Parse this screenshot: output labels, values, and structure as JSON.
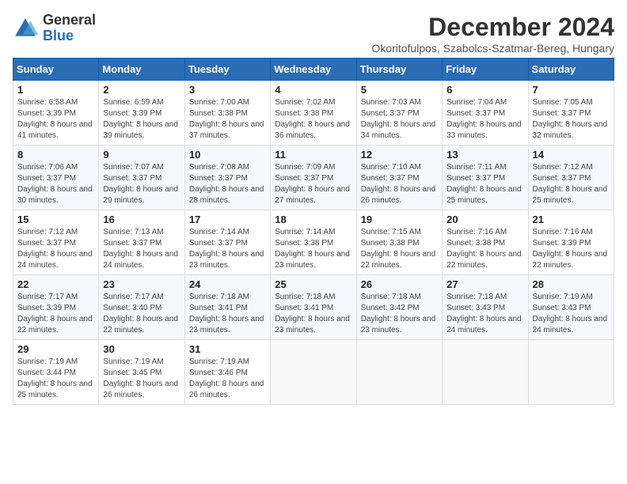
{
  "header": {
    "logo_general": "General",
    "logo_blue": "Blue",
    "title": "December 2024",
    "subtitle": "Okoritofulpos, Szabolcs-Szatmar-Bereg, Hungary"
  },
  "weekdays": [
    "Sunday",
    "Monday",
    "Tuesday",
    "Wednesday",
    "Thursday",
    "Friday",
    "Saturday"
  ],
  "weeks": [
    [
      {
        "day": "1",
        "sunrise": "6:58 AM",
        "sunset": "3:39 PM",
        "daylight": "8 hours and 41 minutes."
      },
      {
        "day": "2",
        "sunrise": "6:59 AM",
        "sunset": "3:39 PM",
        "daylight": "8 hours and 39 minutes."
      },
      {
        "day": "3",
        "sunrise": "7:00 AM",
        "sunset": "3:38 PM",
        "daylight": "8 hours and 37 minutes."
      },
      {
        "day": "4",
        "sunrise": "7:02 AM",
        "sunset": "3:38 PM",
        "daylight": "8 hours and 36 minutes."
      },
      {
        "day": "5",
        "sunrise": "7:03 AM",
        "sunset": "3:37 PM",
        "daylight": "8 hours and 34 minutes."
      },
      {
        "day": "6",
        "sunrise": "7:04 AM",
        "sunset": "3:37 PM",
        "daylight": "8 hours and 33 minutes."
      },
      {
        "day": "7",
        "sunrise": "7:05 AM",
        "sunset": "3:37 PM",
        "daylight": "8 hours and 32 minutes."
      }
    ],
    [
      {
        "day": "8",
        "sunrise": "7:06 AM",
        "sunset": "3:37 PM",
        "daylight": "8 hours and 30 minutes."
      },
      {
        "day": "9",
        "sunrise": "7:07 AM",
        "sunset": "3:37 PM",
        "daylight": "8 hours and 29 minutes."
      },
      {
        "day": "10",
        "sunrise": "7:08 AM",
        "sunset": "3:37 PM",
        "daylight": "8 hours and 28 minutes."
      },
      {
        "day": "11",
        "sunrise": "7:09 AM",
        "sunset": "3:37 PM",
        "daylight": "8 hours and 27 minutes."
      },
      {
        "day": "12",
        "sunrise": "7:10 AM",
        "sunset": "3:37 PM",
        "daylight": "8 hours and 26 minutes."
      },
      {
        "day": "13",
        "sunrise": "7:11 AM",
        "sunset": "3:37 PM",
        "daylight": "8 hours and 25 minutes."
      },
      {
        "day": "14",
        "sunrise": "7:12 AM",
        "sunset": "3:37 PM",
        "daylight": "8 hours and 25 minutes."
      }
    ],
    [
      {
        "day": "15",
        "sunrise": "7:12 AM",
        "sunset": "3:37 PM",
        "daylight": "8 hours and 24 minutes."
      },
      {
        "day": "16",
        "sunrise": "7:13 AM",
        "sunset": "3:37 PM",
        "daylight": "8 hours and 24 minutes."
      },
      {
        "day": "17",
        "sunrise": "7:14 AM",
        "sunset": "3:37 PM",
        "daylight": "8 hours and 23 minutes."
      },
      {
        "day": "18",
        "sunrise": "7:14 AM",
        "sunset": "3:38 PM",
        "daylight": "8 hours and 23 minutes."
      },
      {
        "day": "19",
        "sunrise": "7:15 AM",
        "sunset": "3:38 PM",
        "daylight": "8 hours and 22 minutes."
      },
      {
        "day": "20",
        "sunrise": "7:16 AM",
        "sunset": "3:38 PM",
        "daylight": "8 hours and 22 minutes."
      },
      {
        "day": "21",
        "sunrise": "7:16 AM",
        "sunset": "3:39 PM",
        "daylight": "8 hours and 22 minutes."
      }
    ],
    [
      {
        "day": "22",
        "sunrise": "7:17 AM",
        "sunset": "3:39 PM",
        "daylight": "8 hours and 22 minutes."
      },
      {
        "day": "23",
        "sunrise": "7:17 AM",
        "sunset": "3:40 PM",
        "daylight": "8 hours and 22 minutes."
      },
      {
        "day": "24",
        "sunrise": "7:18 AM",
        "sunset": "3:41 PM",
        "daylight": "8 hours and 23 minutes."
      },
      {
        "day": "25",
        "sunrise": "7:18 AM",
        "sunset": "3:41 PM",
        "daylight": "8 hours and 23 minutes."
      },
      {
        "day": "26",
        "sunrise": "7:18 AM",
        "sunset": "3:42 PM",
        "daylight": "8 hours and 23 minutes."
      },
      {
        "day": "27",
        "sunrise": "7:18 AM",
        "sunset": "3:43 PM",
        "daylight": "8 hours and 24 minutes."
      },
      {
        "day": "28",
        "sunrise": "7:19 AM",
        "sunset": "3:43 PM",
        "daylight": "8 hours and 24 minutes."
      }
    ],
    [
      {
        "day": "29",
        "sunrise": "7:19 AM",
        "sunset": "3:44 PM",
        "daylight": "8 hours and 25 minutes."
      },
      {
        "day": "30",
        "sunrise": "7:19 AM",
        "sunset": "3:45 PM",
        "daylight": "8 hours and 26 minutes."
      },
      {
        "day": "31",
        "sunrise": "7:19 AM",
        "sunset": "3:46 PM",
        "daylight": "8 hours and 26 minutes."
      },
      null,
      null,
      null,
      null
    ]
  ],
  "labels": {
    "sunrise": "Sunrise:",
    "sunset": "Sunset:",
    "daylight": "Daylight:"
  }
}
